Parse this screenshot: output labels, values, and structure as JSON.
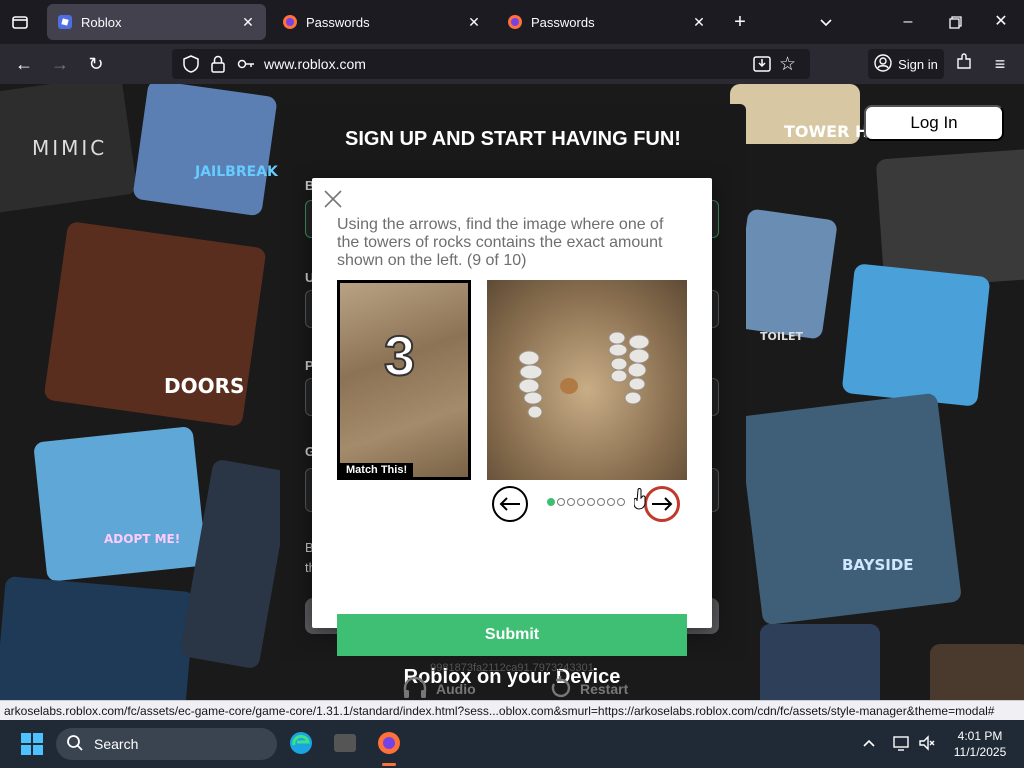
{
  "browser": {
    "tabs": [
      {
        "title": "Roblox",
        "active": true
      },
      {
        "title": "Passwords",
        "active": false
      },
      {
        "title": "Passwords",
        "active": false
      }
    ],
    "url": "www.roblox.com",
    "sign_in_label": "Sign in"
  },
  "page": {
    "login_label": "Log In",
    "signup_title": "SIGN UP AND START HAVING FUN!",
    "device_heading": "Roblox on your Device",
    "game_labels": [
      "MIMIC",
      "DOORS",
      "JAILBREAK",
      "TOWER HEROES",
      "TOILET",
      "ADOPT ME!",
      "BAYSIDE"
    ]
  },
  "captcha": {
    "instruction": "Using the arrows, find the image where one of the towers of rocks contains the exact amount shown on the left. (9 of 10)",
    "target_number": "3",
    "match_label": "Match This!",
    "dot_count": 8,
    "active_dot": 0,
    "submit_label": "Submit",
    "session_id": "9981873fa2112ca91.7973243301",
    "audio_label": "Audio",
    "restart_label": "Restart",
    "accent_color": "#3fbf74"
  },
  "status_bar": {
    "text": "arkoselabs.roblox.com/fc/assets/ec-game-core/game-core/1.31.1/standard/index.html?sess...oblox.com&smurl=https://arkoselabs.roblox.com/cdn/fc/assets/style-manager&theme=modal#"
  },
  "taskbar": {
    "search_label": "Search",
    "time": "4:01 PM",
    "date": "11/1/2025"
  }
}
